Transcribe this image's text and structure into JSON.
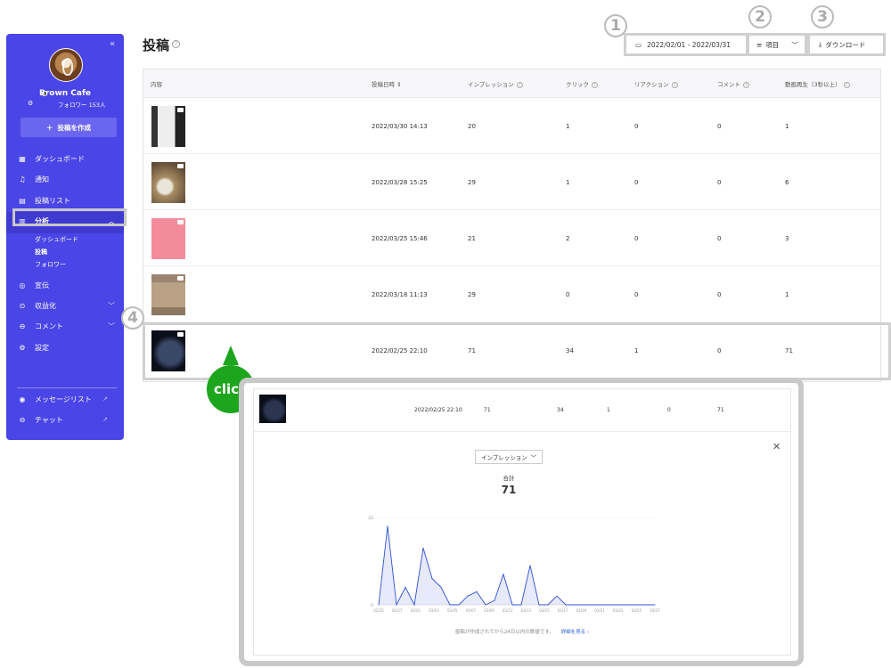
{
  "sidebar": {
    "collapse": "«",
    "brand": "Brown Cafe",
    "followers": "フォロワー 153人",
    "create": "投稿を作成",
    "nav": [
      {
        "label": "ダッシュボード",
        "icon": "grid-icon"
      },
      {
        "label": "通知",
        "icon": "bell-icon"
      },
      {
        "label": "投稿リスト",
        "icon": "document-icon"
      },
      {
        "label": "分析",
        "icon": "bar-chart-icon"
      },
      {
        "label": "宣伝",
        "icon": "megaphone-icon"
      },
      {
        "label": "収益化",
        "icon": "coin-icon"
      },
      {
        "label": "コメント",
        "icon": "comment-icon"
      },
      {
        "label": "設定",
        "icon": "gear-icon"
      },
      {
        "label": "メッセージリスト",
        "icon": "message-list-icon"
      },
      {
        "label": "チャット",
        "icon": "chat-icon"
      }
    ],
    "sub": [
      "ダッシュボード",
      "投稿",
      "フォロワー"
    ]
  },
  "main": {
    "title": "投稿",
    "date_range": "2022/02/01 - 2022/03/31",
    "columns_btn": "項目",
    "download": "ダウンロード"
  },
  "badges": [
    "1",
    "2",
    "3",
    "4"
  ],
  "table": {
    "headers": [
      "内容",
      "投稿日時",
      "インプレッション",
      "クリック",
      "リアクション",
      "コメント",
      "動画再生（3秒以上）"
    ],
    "rows": [
      {
        "date": "2022/03/30 14:13",
        "imp": "20",
        "click": "1",
        "react": "0",
        "comment": "0",
        "video": "1"
      },
      {
        "date": "2022/03/28 15:25",
        "imp": "29",
        "click": "1",
        "react": "0",
        "comment": "0",
        "video": "6"
      },
      {
        "date": "2022/03/25 15:46",
        "imp": "21",
        "click": "2",
        "react": "0",
        "comment": "0",
        "video": "3"
      },
      {
        "date": "2022/03/18 11:13",
        "imp": "29",
        "click": "0",
        "react": "0",
        "comment": "0",
        "video": "1"
      },
      {
        "date": "2022/02/25 22:10",
        "imp": "71",
        "click": "34",
        "react": "1",
        "comment": "0",
        "video": "71"
      }
    ]
  },
  "callout": "click",
  "popup": {
    "row": {
      "date": "2022/02/25 22:10",
      "imp": "71",
      "click": "34",
      "react": "1",
      "comment": "0",
      "video": "71"
    },
    "select": "インプレッション",
    "total_label": "合計",
    "total": "71",
    "footnote": "投稿が作成されてから24日以内の数値です。",
    "link": "詳細を見る ›"
  },
  "chart_data": {
    "type": "area",
    "x": [
      "02/25",
      "02/27",
      "03/01",
      "03/03",
      "03/05",
      "03/07",
      "03/09",
      "03/11",
      "03/13",
      "03/15",
      "03/17",
      "03/19",
      "03/21",
      "03/23",
      "03/25",
      "03/27"
    ],
    "values": [
      0,
      18,
      0,
      4,
      0,
      13,
      6,
      4,
      0,
      0,
      2,
      3,
      0,
      1,
      7,
      0,
      0,
      9,
      0,
      0,
      2,
      0,
      0,
      0,
      0,
      0,
      0,
      0,
      0,
      0,
      0,
      0
    ],
    "ylim": [
      0,
      20
    ],
    "yticks": [
      "20",
      "0"
    ],
    "color": "#2e4fd6"
  }
}
